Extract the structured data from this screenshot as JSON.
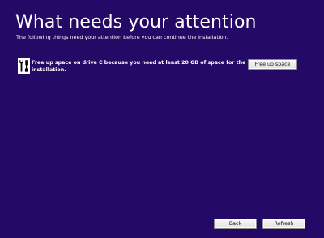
{
  "page": {
    "title": "What needs your attention",
    "subtitle": "The following things need your attention before you can continue the installation."
  },
  "issues": [
    {
      "icon": "tools-icon",
      "text": "Free up space on drive C because you need at least 20 GB of space for the installation.",
      "action_label": "Free up space"
    }
  ],
  "footer": {
    "back_label": "Back",
    "refresh_label": "Refresh"
  },
  "colors": {
    "background": "#250966",
    "text": "#ffffff",
    "button_face": "#e9e9e9"
  }
}
